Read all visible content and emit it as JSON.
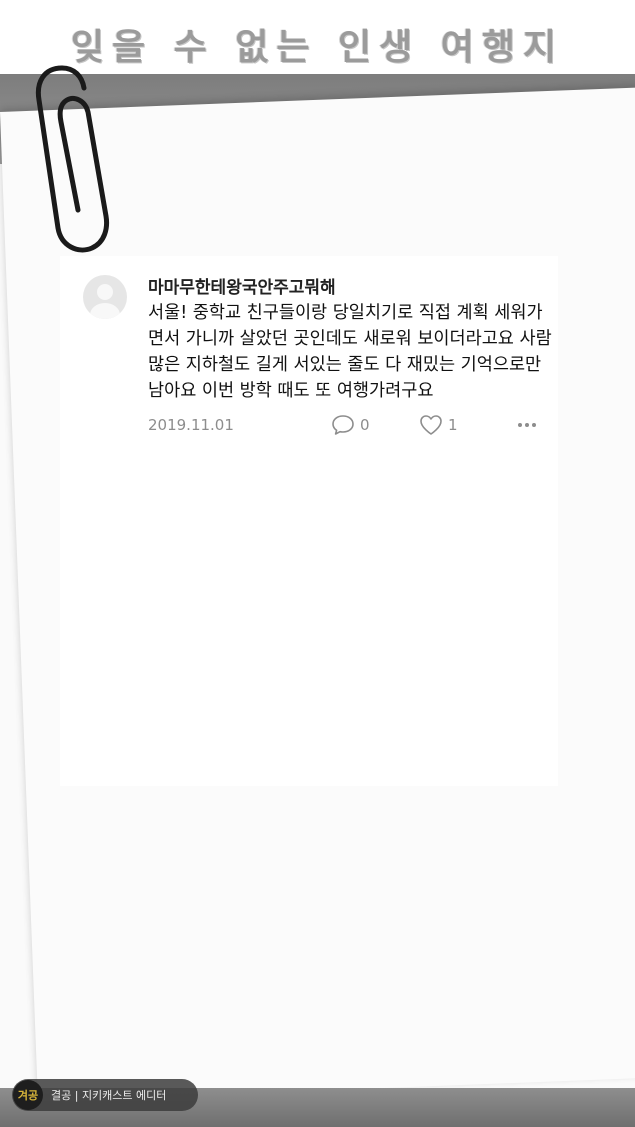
{
  "header": {
    "title": "잊을 수 없는 인생 여행지"
  },
  "post": {
    "username": "마마무한테왕국안주고뭐해",
    "text": "서울! 중학교 친구들이랑 당일치기로 직접 계획 세워가면서 가니까 살았던 곳인데도 새로워 보이더라고요 사람 많은 지하철도 길게 서있는 줄도 다 재밌는 기억으로만 남아요 이번 방학 때도 또 여행가려구요",
    "date": "2019.11.01",
    "comment_count": "0",
    "like_count": "1"
  },
  "badge": {
    "logo_text": "겨공",
    "text": "결공 | 지키캐스트 에디터"
  },
  "icons": {
    "avatar": "default-avatar-icon",
    "comment": "comment-bubble-icon",
    "like": "heart-icon",
    "more": "more-dots-icon",
    "clip": "paperclip-icon"
  },
  "colors": {
    "text_primary": "#111111",
    "text_secondary": "#8d8d8d",
    "band_gray": "#858585",
    "badge_logo_gold": "#d8b53a"
  }
}
